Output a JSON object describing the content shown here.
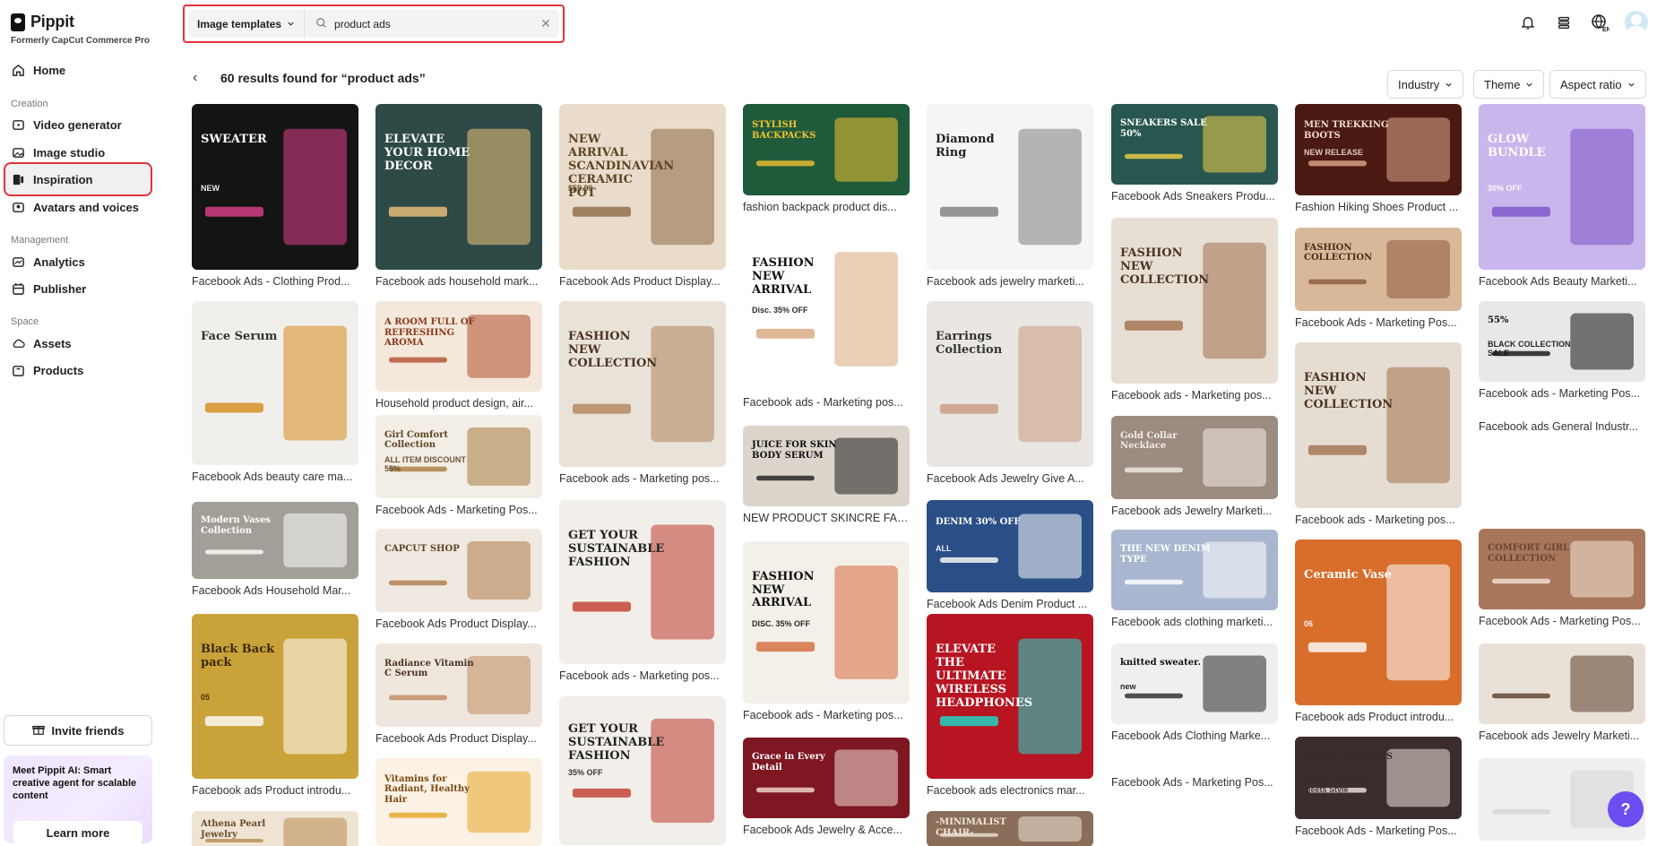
{
  "brand": {
    "name": "Pippit",
    "subtitle": "Formerly CapCut Commerce Pro"
  },
  "sidebar": {
    "home": "Home",
    "creation_label": "Creation",
    "video_generator": "Video generator",
    "image_studio": "Image studio",
    "inspiration": "Inspiration",
    "avatars": "Avatars and voices",
    "management_label": "Management",
    "analytics": "Analytics",
    "publisher": "Publisher",
    "space_label": "Space",
    "assets": "Assets",
    "products": "Products",
    "invite": "Invite friends",
    "promo_text": "Meet Pippit AI: Smart creative agent for scalable content",
    "promo_button": "Learn more"
  },
  "search": {
    "type_label": "Image templates",
    "query": "product ads"
  },
  "results": {
    "title": "60 results found for “product ads”"
  },
  "filters": {
    "industry": "Industry",
    "theme": "Theme",
    "aspect": "Aspect ratio"
  },
  "cards": [
    {
      "caption": "Facebook Ads - Clothing Prod...",
      "label": "SWEATER",
      "sublabel": "NEW",
      "bg": "#141414",
      "accent": "#e0408a",
      "fg": "#ffffff"
    },
    {
      "caption": "Facebook Ads beauty care ma...",
      "label": "Face Serum",
      "sublabel": "",
      "bg": "#f1efec",
      "accent": "#d68a1b",
      "fg": "#333333"
    },
    {
      "caption": "Facebook Ads Household Mar...",
      "label": "Modern Vases Collection",
      "sublabel": "",
      "bg": "#a29e98",
      "accent": "#ffffff",
      "fg": "#ffffff"
    },
    {
      "caption": "Facebook ads Product introdu...",
      "label": "Black Back pack",
      "sublabel": "05",
      "bg": "#c9a23a",
      "accent": "#ffffff",
      "fg": "#3b2a08"
    },
    {
      "caption": "",
      "label": "Athena Pearl Jewelry",
      "sublabel": "",
      "bg": "#efe4d4",
      "accent": "#b98a51",
      "fg": "#6b4d28"
    },
    {
      "caption": "Facebook ads household mark...",
      "label": "ELEVATE YOUR HOME DECOR",
      "sublabel": "",
      "bg": "#2e4a47",
      "accent": "#f0c27a",
      "fg": "#ffffff"
    },
    {
      "caption": "Household product design, air...",
      "label": "A ROOM FULL OF REFRESHING AROMA",
      "sublabel": "",
      "bg": "#f4e8dc",
      "accent": "#b14f2c",
      "fg": "#8a3a1c"
    },
    {
      "caption": "Facebook Ads - Marketing Pos...",
      "label": "Girl Comfort Collection",
      "sublabel": "ALL ITEM DISCOUNT 55%",
      "bg": "#f2eee6",
      "accent": "#a67a3d",
      "fg": "#5e4424"
    },
    {
      "caption": "Facebook Ads Product Display...",
      "label": "CAPCUT SHOP",
      "sublabel": "",
      "bg": "#efe9e1",
      "accent": "#b07a49",
      "fg": "#5e4424"
    },
    {
      "caption": "Facebook Ads Product Display...",
      "label": "Radiance Vitamin C Serum",
      "sublabel": "",
      "bg": "#efe6dd",
      "accent": "#c08a5e",
      "fg": "#4a3423"
    },
    {
      "caption": "",
      "label": "Vitamins for Radiant, Healthy Hair",
      "sublabel": "",
      "bg": "#fbf1e4",
      "accent": "#e5a627",
      "fg": "#7a4a12"
    },
    {
      "caption": "Facebook Ads Product Display...",
      "label": "NEW ARRIVAL SCANDINAVIAN CERAMIC POT",
      "sublabel": "$59.99",
      "bg": "#e9dccb",
      "accent": "#8c6a45",
      "fg": "#5e4424"
    },
    {
      "caption": "Facebook ads - Marketing pos...",
      "label": "FASHION NEW COLLECTION",
      "sublabel": "",
      "bg": "#e9e2d9",
      "accent": "#b3855b",
      "fg": "#4a3423"
    },
    {
      "caption": "Facebook ads - Marketing pos...",
      "label": "GET YOUR SUSTAINABLE FASHION",
      "sublabel": "",
      "bg": "#f2efea",
      "accent": "#c0392b",
      "fg": "#222222"
    },
    {
      "caption": "",
      "label": "GET YOUR SUSTAINABLE FASHION",
      "sublabel": "35% OFF",
      "bg": "#f2efea",
      "accent": "#c0392b",
      "fg": "#222222"
    },
    {
      "caption": "fashion backpack product dis...",
      "label": "STYLISH BACKPACKS",
      "sublabel": "",
      "bg": "#1f5a3a",
      "accent": "#f1c232",
      "fg": "#f1c232"
    },
    {
      "caption": "Facebook ads - Marketing pos...",
      "label": "FASHION NEW ARRIVAL",
      "sublabel": "Disc. 35% OFF",
      "bg": "#ffffff",
      "accent": "#d8a57a",
      "fg": "#111111"
    },
    {
      "caption": "NEW PRODUCT SKINCRE FAC...",
      "label": "JUICE FOR SKIN BODY SERUM",
      "sublabel": "",
      "bg": "#dcd5cb",
      "accent": "#1d1d1d",
      "fg": "#111111"
    },
    {
      "caption": "Facebook ads - Marketing pos...",
      "label": "FASHION NEW ARRIVAL",
      "sublabel": "DISC. 35% OFF",
      "bg": "#f3f0ea",
      "accent": "#d66a3a",
      "fg": "#111111"
    },
    {
      "caption": "Facebook Ads Jewelry & Acce...",
      "label": "Grace in Every Detail",
      "sublabel": "",
      "bg": "#7e1722",
      "accent": "#f6e0d7",
      "fg": "#ffffff"
    },
    {
      "caption": "Facebook ads jewelry marketi...",
      "label": "Diamond Ring",
      "sublabel": "",
      "bg": "#f5f5f5",
      "accent": "#7d7d7d",
      "fg": "#222222"
    },
    {
      "caption": "Facebook Ads Jewelry Give A...",
      "label": "Earrings Collection",
      "sublabel": "",
      "bg": "#eae7e3",
      "accent": "#c99a80",
      "fg": "#333333"
    },
    {
      "caption": "Facebook Ads Denim Product ...",
      "label": "DENIM 30% OFF",
      "sublabel": "ALL",
      "bg": "#2a4f86",
      "accent": "#ffffff",
      "fg": "#ffffff"
    },
    {
      "caption": "Facebook ads electronics mar...",
      "label": "ELEVATE THE ULTIMATE WIRELESS HEADPHONES",
      "sublabel": "",
      "bg": "#b71522",
      "accent": "#16e0d0",
      "fg": "#ffffff"
    },
    {
      "caption": "",
      "label": "-MINIMALIST CHAIR-",
      "sublabel": "",
      "bg": "#8a6e5a",
      "accent": "#f1e5d6",
      "fg": "#f1e5d6"
    },
    {
      "caption": "Facebook Ads Sneakers Produ...",
      "label": "SNEAKERS SALE 50%",
      "sublabel": "",
      "bg": "#27574e",
      "accent": "#f4d04a",
      "fg": "#ffffff"
    },
    {
      "caption": "Facebook ads - Marketing pos...",
      "label": "FASHION NEW COLLECTION",
      "sublabel": "",
      "bg": "#e7ded4",
      "accent": "#a1714c",
      "fg": "#4a3423"
    },
    {
      "caption": "Facebook ads Jewelry Marketi...",
      "label": "Gold Collar Necklace",
      "sublabel": "",
      "bg": "#9b8b80",
      "accent": "#f4ede6",
      "fg": "#f4ede6"
    },
    {
      "caption": "Facebook ads clothing marketi...",
      "label": "THE NEW DENIM TYPE",
      "sublabel": "",
      "bg": "#a8b7cf",
      "accent": "#ffffff",
      "fg": "#ffffff"
    },
    {
      "caption": "Facebook Ads Clothing Marke...",
      "label": "knitted sweater.",
      "sublabel": "new",
      "bg": "#efefef",
      "accent": "#262626",
      "fg": "#111111"
    },
    {
      "caption": "Facebook Ads - Marketing Pos...",
      "label": "",
      "sublabel": "",
      "bg": "#ffffff",
      "accent": "#ffffff",
      "fg": "#ffffff"
    },
    {
      "caption": "Fashion Hiking Shoes Product ...",
      "label": "MEN TREKKING BOOTS",
      "sublabel": "NEW RELEASE",
      "bg": "#4a1a12",
      "accent": "#e0a78a",
      "fg": "#f1d9c8"
    },
    {
      "caption": "Facebook Ads - Marketing Pos...",
      "label": "FASHION COLLECTION",
      "sublabel": "",
      "bg": "#d9b89a",
      "accent": "#8a5a3a",
      "fg": "#4a2e1a"
    },
    {
      "caption": "Facebook ads - Marketing pos...",
      "label": "FASHION NEW COLLECTION",
      "sublabel": "",
      "bg": "#e6ddd2",
      "accent": "#a1714c",
      "fg": "#4a3423"
    },
    {
      "caption": "Facebook ads Product introdu...",
      "label": "Ceramic Vase",
      "sublabel": "06",
      "bg": "#d86e2b",
      "accent": "#ffffff",
      "fg": "#ffffff"
    },
    {
      "caption": "Facebook Ads - Marketing Pos...",
      "label": "MEN'S WATCHES",
      "sublabel": "Where Precision Meets Style",
      "bg": "#3b2d2d",
      "accent": "#f0e6df",
      "fg": "#3b2d2d"
    },
    {
      "caption": "Facebook Ads Beauty Marketi...",
      "label": "GLOW BUNDLE",
      "sublabel": "30% OFF",
      "bg": "#c9b6ec",
      "accent": "#7a53c9",
      "fg": "#ffffff"
    },
    {
      "caption": "Facebook ads - Marketing Pos...",
      "label": "55%",
      "sublabel": "BLACK COLLECTION SALE",
      "bg": "#e8e8e8",
      "accent": "#111111",
      "fg": "#111111"
    },
    {
      "caption": "Facebook ads General Industr...",
      "label": "",
      "sublabel": "",
      "bg": "#ffffff",
      "accent": "#ffffff",
      "fg": "#ffffff"
    },
    {
      "caption": "Facebook Ads - Marketing Pos...",
      "label": "COMFORT GIRL COLLECTION",
      "sublabel": "",
      "bg": "#a8765a",
      "accent": "#f3e5da",
      "fg": "#6b4530"
    },
    {
      "caption": "Facebook ads Jewelry Marketi...",
      "label": "",
      "sublabel": "",
      "bg": "#e9e1d8",
      "accent": "#5b3c2a",
      "fg": "#5b3c2a"
    },
    {
      "caption": "",
      "label": "",
      "sublabel": "",
      "bg": "#efefef",
      "accent": "#d5d5d5",
      "fg": "#d5d5d5"
    }
  ]
}
